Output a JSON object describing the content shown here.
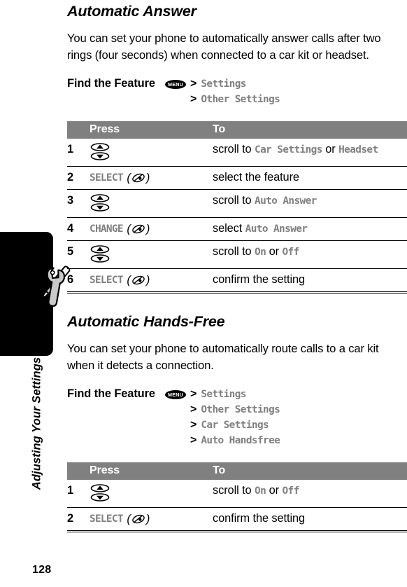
{
  "page": {
    "number": "128",
    "side_label": "Adjusting Your Settings",
    "side_icon": "wrench-screwdriver-icon"
  },
  "sections": [
    {
      "title": "Automatic Answer",
      "body": "You can set your phone to automatically answer calls after two rings (four seconds) when connected to a car kit or headset.",
      "find_the_feature": {
        "label": "Find the Feature",
        "menu_key": "MENU",
        "path": [
          "Settings",
          "Other Settings"
        ]
      },
      "table": {
        "headers": {
          "press": "Press",
          "to": "To"
        },
        "rows": [
          {
            "num": "1",
            "press_icon": "scroll-up-down-key-icon",
            "press_label": "",
            "to_prefix": "scroll to ",
            "to_display": "Car Settings",
            "to_mid": " or ",
            "to_display2": "Headset",
            "to_suffix": ""
          },
          {
            "num": "2",
            "press_icon": "select-key-icon",
            "press_label": "SELECT",
            "to_prefix": "select the feature",
            "to_display": "",
            "to_mid": "",
            "to_display2": "",
            "to_suffix": ""
          },
          {
            "num": "3",
            "press_icon": "scroll-up-down-key-icon",
            "press_label": "",
            "to_prefix": "scroll to ",
            "to_display": "Auto Answer",
            "to_mid": "",
            "to_display2": "",
            "to_suffix": ""
          },
          {
            "num": "4",
            "press_icon": "select-key-icon",
            "press_label": "CHANGE",
            "to_prefix": "select ",
            "to_display": "Auto Answer",
            "to_mid": "",
            "to_display2": "",
            "to_suffix": ""
          },
          {
            "num": "5",
            "press_icon": "scroll-up-down-key-icon",
            "press_label": "",
            "to_prefix": "scroll to ",
            "to_display": "On",
            "to_mid": " or ",
            "to_display2": "Off",
            "to_suffix": ""
          },
          {
            "num": "6",
            "press_icon": "select-key-icon",
            "press_label": "SELECT",
            "to_prefix": "confirm the setting",
            "to_display": "",
            "to_mid": "",
            "to_display2": "",
            "to_suffix": ""
          }
        ]
      }
    },
    {
      "title": "Automatic Hands-Free",
      "body": "You can set your phone to automatically route calls to a car kit when it detects a connection.",
      "find_the_feature": {
        "label": "Find the Feature",
        "menu_key": "MENU",
        "path": [
          "Settings",
          "Other Settings",
          "Car Settings",
          "Auto Handsfree"
        ]
      },
      "table": {
        "headers": {
          "press": "Press",
          "to": "To"
        },
        "rows": [
          {
            "num": "1",
            "press_icon": "scroll-up-down-key-icon",
            "press_label": "",
            "to_prefix": "scroll to ",
            "to_display": "On",
            "to_mid": " or ",
            "to_display2": "Off",
            "to_suffix": ""
          },
          {
            "num": "2",
            "press_icon": "select-key-icon",
            "press_label": "SELECT",
            "to_prefix": "confirm the setting",
            "to_display": "",
            "to_mid": "",
            "to_display2": "",
            "to_suffix": ""
          }
        ]
      }
    }
  ],
  "colors": {
    "display_text": "#808080",
    "table_header_bg": "#808080",
    "side_tab": "#000000",
    "tool_gray": "#b3b3b3"
  }
}
